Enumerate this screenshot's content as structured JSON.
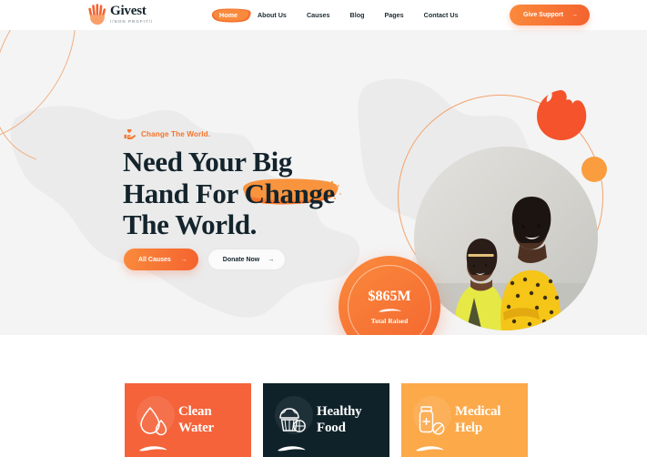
{
  "brand": {
    "name": "Givest",
    "tagline": "//NON PROFIT//",
    "logo_icon": "open-hand-icon",
    "accent": "#F4632F",
    "accent_light": "#FA8A3C",
    "dark": "#14242C"
  },
  "header": {
    "nav": [
      {
        "label": "Home",
        "active": true
      },
      {
        "label": "About Us",
        "active": false
      },
      {
        "label": "Causes",
        "active": false
      },
      {
        "label": "Blog",
        "active": false
      },
      {
        "label": "Pages",
        "active": false
      },
      {
        "label": "Contact Us",
        "active": false
      }
    ],
    "cta": {
      "label": "Give Support",
      "arrow": "→",
      "icon": "arrow-right-icon"
    }
  },
  "hero": {
    "eyebrow": {
      "text": "Change The World.",
      "icon": "hand-heart-icon"
    },
    "headline": {
      "line1": "Need Your Big",
      "line2_prefix": "Hand For ",
      "line2_accent": "Change",
      "line3": "The World."
    },
    "buttons": [
      {
        "label": "All Causes",
        "style": "primary",
        "arrow": "→"
      },
      {
        "label": "Donate Now",
        "style": "ghost",
        "arrow": "→"
      }
    ],
    "badge": {
      "amount": "$865M",
      "label": "Total Raised"
    },
    "photo_alt": "two-young-people-photo",
    "decor": [
      "orange-blob-shape",
      "orange-small-circle",
      "orange-ring-outline",
      "world-map-silhouette",
      "orange-curve-lines"
    ]
  },
  "cards": [
    {
      "title_line1": "Clean",
      "title_line2": "Water",
      "icon": "water-drop-icon",
      "bg": "#F4633A",
      "text_color": "#FFFFFF"
    },
    {
      "title_line1": "Healthy",
      "title_line2": "Food",
      "icon": "food-basket-icon",
      "bg": "#0F2229",
      "text_color": "#FFFFFF"
    },
    {
      "title_line1": "Medical",
      "title_line2": "Help",
      "icon": "medicine-bottle-icon",
      "bg": "#FCA94A",
      "text_color": "#FFFFFF"
    }
  ]
}
